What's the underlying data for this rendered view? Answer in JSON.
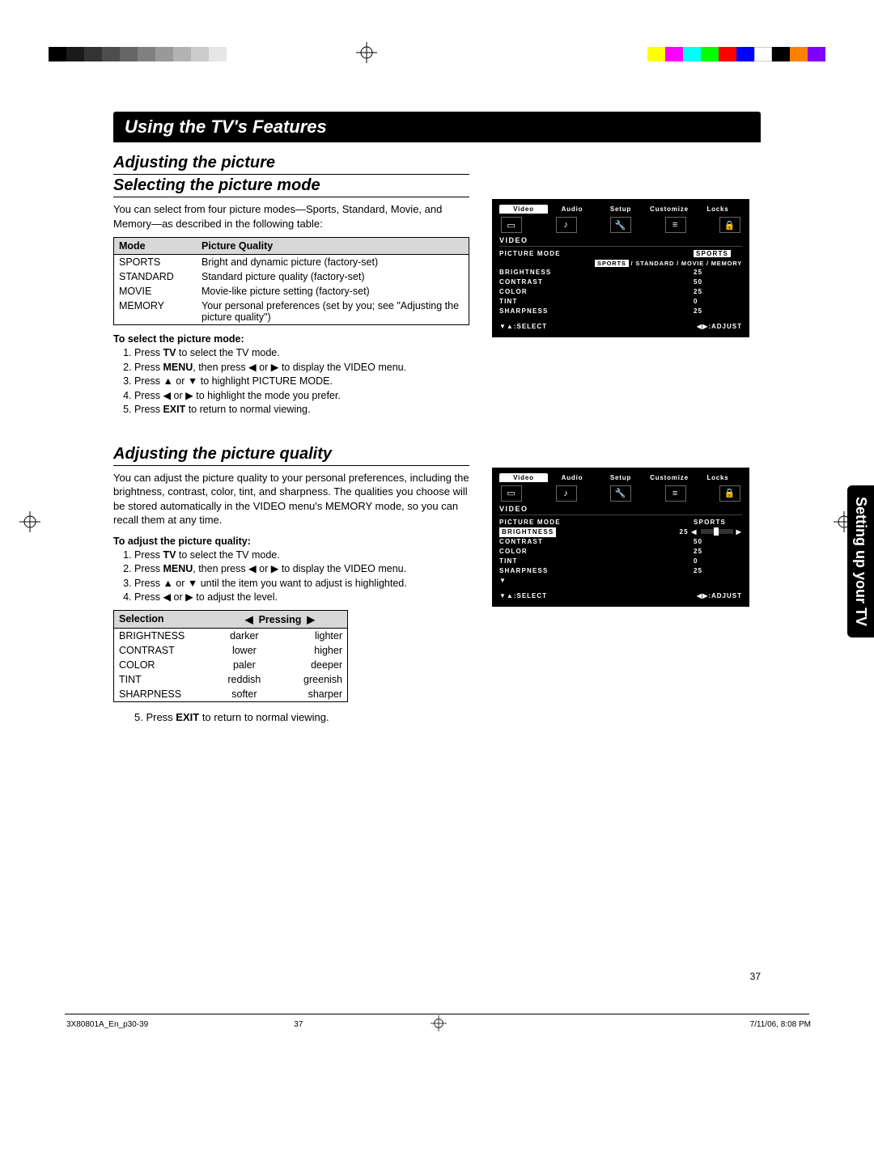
{
  "chapter_title": "Using the TV's Features",
  "section1": {
    "h1": "Adjusting the picture",
    "h2": "Selecting the picture mode",
    "intro": "You can select from four picture modes—Sports, Standard, Movie, and Memory—as described in the following table:",
    "table": {
      "head_mode": "Mode",
      "head_quality": "Picture Quality",
      "rows": [
        {
          "mode": "SPORTS",
          "desc": "Bright and dynamic picture (factory-set)"
        },
        {
          "mode": "STANDARD",
          "desc": "Standard picture quality (factory-set)"
        },
        {
          "mode": "MOVIE",
          "desc": "Movie-like picture setting (factory-set)"
        },
        {
          "mode": "MEMORY",
          "desc": "Your personal preferences (set by you; see \"Adjusting the picture quality\")"
        }
      ]
    },
    "instr_head": "To select the picture mode:",
    "steps": [
      "Press TV to select the TV mode.",
      "Press MENU, then press ◀ or ▶ to display the VIDEO menu.",
      "Press ▲ or ▼ to highlight PICTURE MODE.",
      "Press ◀ or ▶ to highlight the mode you prefer.",
      "Press EXIT to return to normal viewing."
    ]
  },
  "section2": {
    "h1": "Adjusting the picture quality",
    "intro": "You can adjust the picture quality to your personal preferences, including the brightness, contrast, color, tint, and sharpness. The qualities you choose will be stored automatically in the VIDEO menu's MEMORY mode, so you can recall them at any time.",
    "instr_head": "To adjust the picture quality:",
    "steps": [
      "Press TV to select the TV mode.",
      "Press MENU, then press ◀ or ▶ to display the VIDEO menu.",
      "Press ▲ or ▼ until the item you want to adjust is highlighted.",
      "Press ◀ or ▶ to adjust the level."
    ],
    "table": {
      "head_sel": "Selection",
      "head_press": "Pressing",
      "rows": [
        {
          "sel": "BRIGHTNESS",
          "left": "darker",
          "right": "lighter"
        },
        {
          "sel": "CONTRAST",
          "left": "lower",
          "right": "higher"
        },
        {
          "sel": "COLOR",
          "left": "paler",
          "right": "deeper"
        },
        {
          "sel": "TINT",
          "left": "reddish",
          "right": "greenish"
        },
        {
          "sel": "SHARPNESS",
          "left": "softer",
          "right": "sharper"
        }
      ]
    },
    "final_step": "5. Press EXIT to return to normal viewing."
  },
  "osd_common": {
    "tabs": [
      "Video",
      "Audio",
      "Setup",
      "Customize",
      "Locks"
    ],
    "menu_title": "VIDEO",
    "select_hint": "▼▲:SELECT",
    "adjust_hint": "◀▶:ADJUST"
  },
  "osd1": {
    "picture_mode_label": "PICTURE MODE",
    "picture_mode_value": "SPORTS",
    "sub_modes": "SPORTS / STANDARD / MOVIE / MEMORY",
    "rows": [
      {
        "label": "BRIGHTNESS",
        "value": "25"
      },
      {
        "label": "CONTRAST",
        "value": "50"
      },
      {
        "label": "COLOR",
        "value": "25"
      },
      {
        "label": "TINT",
        "value": "0"
      },
      {
        "label": "SHARPNESS",
        "value": "25"
      }
    ]
  },
  "osd2": {
    "picture_mode_label": "PICTURE MODE",
    "picture_mode_value": "SPORTS",
    "highlight_row": {
      "label": "BRIGHTNESS",
      "value": "25"
    },
    "rows": [
      {
        "label": "CONTRAST",
        "value": "50"
      },
      {
        "label": "COLOR",
        "value": "25"
      },
      {
        "label": "TINT",
        "value": "0"
      },
      {
        "label": "SHARPNESS",
        "value": "25"
      }
    ]
  },
  "sidetab": "Setting up your TV",
  "page_number": "37",
  "footer": {
    "file": "3X80801A_En_p30-39",
    "page": "37",
    "date": "7/11/06, 8:08 PM"
  }
}
